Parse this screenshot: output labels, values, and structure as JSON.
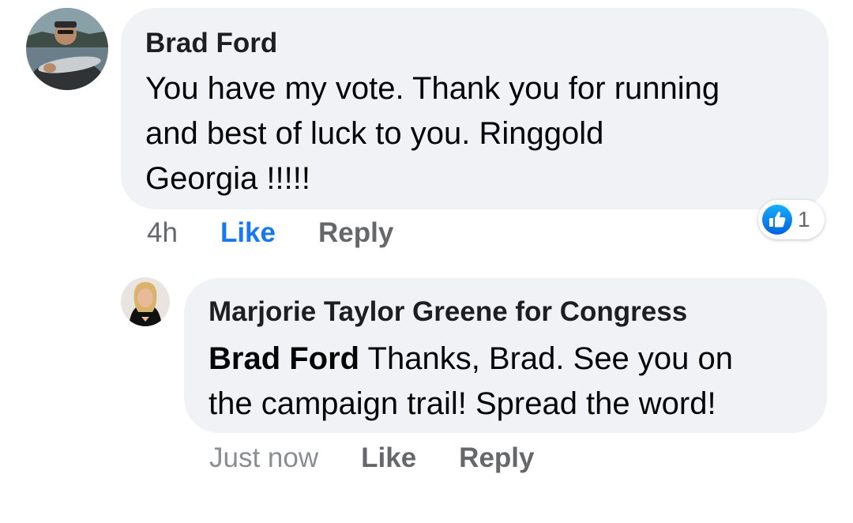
{
  "colors": {
    "accent": "#1877f2",
    "bubble": "#f0f2f5",
    "muted": "#65676b"
  },
  "comments": [
    {
      "author": "Brad Ford",
      "text_line1": "You have my vote. Thank you for running",
      "text_line2": "and best of luck to you. Ringgold",
      "text_line3": "Georgia !!!!!",
      "time": "4h",
      "like_label": "Like",
      "reply_label": "Reply",
      "reaction_icon": "thumbs-up-icon",
      "reaction_count": "1"
    }
  ],
  "reply": {
    "author": "Marjorie Taylor Greene for Congress",
    "mention": "Brad Ford",
    "text_line1": " Thanks, Brad. See you on",
    "text_line2": "the campaign trail! Spread the word!",
    "time": "Just now",
    "like_label": "Like",
    "reply_label": "Reply"
  }
}
